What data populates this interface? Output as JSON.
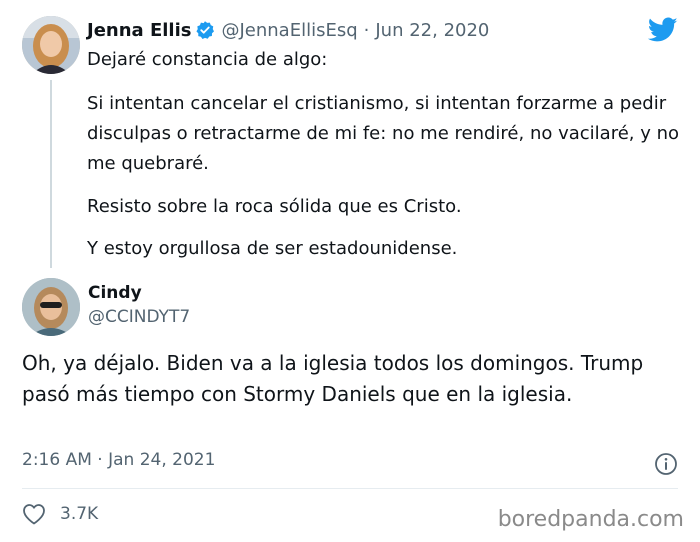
{
  "tweet": {
    "author": {
      "name": "Jenna Ellis",
      "handle": "@JennaEllisEsq",
      "date": "Jun 22, 2020",
      "verified": true
    },
    "separator": "·",
    "paragraphs": [
      "Dejaré constancia de algo:",
      "Si intentan cancelar el cristianismo, si intentan forzarme a pedir disculpas o retractarme de mi fe: no me rendiré, no vacilaré, y no me quebraré.",
      "Resisto sobre la roca sólida que es Cristo.",
      "Y estoy orgullosa de ser estadounidense."
    ]
  },
  "reply": {
    "author": {
      "name": "Cindy",
      "handle": "@CCINDYT7"
    },
    "text": "Oh, ya déjalo. Biden va a la iglesia todos los domingos. Trump pasó más tiempo con Stormy Daniels que en la iglesia.",
    "timestamp": "2:16 AM · Jan 24, 2021",
    "likes": "3.7K"
  },
  "icons": {
    "verified": "verified-badge-icon",
    "brand": "twitter-bird-icon",
    "info": "info-icon",
    "like": "heart-icon"
  },
  "colors": {
    "twitter_blue": "#1d9bf0",
    "text": "#0f1419",
    "secondary": "#536471"
  },
  "watermark": "boredpanda.com"
}
